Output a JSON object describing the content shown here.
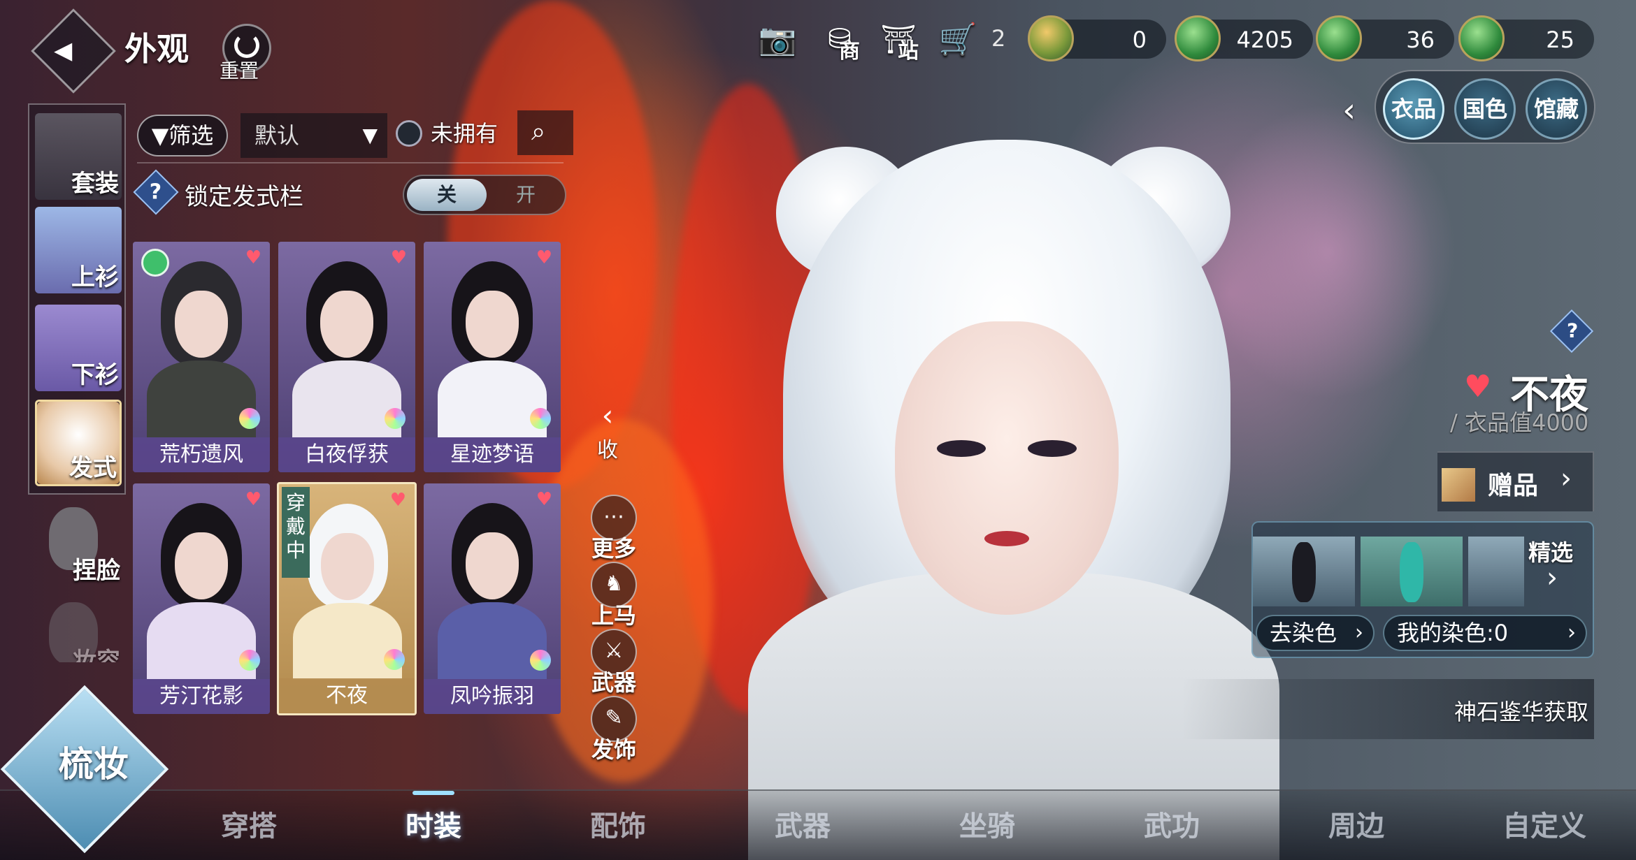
{
  "header": {
    "title": "外观",
    "reset_label": "重置",
    "back_icon": "back-arrow-icon",
    "shop_label": "商",
    "site_label": "站",
    "cart_count": "2"
  },
  "currencies": [
    {
      "icon": "jade-coin-icon",
      "value": "0"
    },
    {
      "icon": "green-jade-plus-icon",
      "value": "4205"
    },
    {
      "icon": "green-jade-plus-icon",
      "value": "36"
    },
    {
      "icon": "green-jade-plus-icon",
      "value": "25"
    }
  ],
  "right_tabs": {
    "items": [
      {
        "label": "衣品",
        "active": true
      },
      {
        "label": "国色",
        "active": false
      },
      {
        "label": "馆藏",
        "active": false
      }
    ]
  },
  "sidebar": {
    "items": [
      {
        "label": "套装"
      },
      {
        "label": "上衫"
      },
      {
        "label": "下衫"
      },
      {
        "label": "发式",
        "active": true
      },
      {
        "label": "捏脸"
      },
      {
        "label": "妆容"
      }
    ]
  },
  "filter": {
    "filter_label": "筛选",
    "sort_value": "默认",
    "not_owned_label": "未拥有",
    "lock_label": "锁定发式栏",
    "toggle_off": "关",
    "toggle_on": "开"
  },
  "items": [
    {
      "name": "荒朽遗风",
      "heart": "♥"
    },
    {
      "name": "白夜俘获",
      "heart": "♥"
    },
    {
      "name": "星迹梦语",
      "heart": "♥"
    },
    {
      "name": "芳汀花影",
      "heart": "♥"
    },
    {
      "name": "不夜",
      "heart": "♥",
      "wearing": "穿戴中",
      "selected": true
    },
    {
      "name": "凤吟振羽",
      "heart": "♥"
    }
  ],
  "actions": {
    "collapse": "收",
    "more": "更多",
    "mount": "上马",
    "weapon": "武器",
    "hair_accessory": "发饰"
  },
  "detail": {
    "name": "不夜",
    "value": "/ 衣品值4000",
    "gift_label": "赠品",
    "picks_label": "精选",
    "undye_label": "去染色",
    "my_dyes_label": "我的染色:0",
    "source_label": "神石鉴华获取"
  },
  "mode_badge": "梳妆",
  "bottom_nav": [
    {
      "label": "穿搭"
    },
    {
      "label": "时装",
      "active": true
    },
    {
      "label": "配饰"
    },
    {
      "label": "武器"
    },
    {
      "label": "坐骑"
    },
    {
      "label": "武功"
    },
    {
      "label": "周边"
    },
    {
      "label": "自定义"
    }
  ],
  "colors": {
    "accent": "#9fe0ff",
    "favorite": "#ff4c5e",
    "selected_card": "#d8b47a",
    "card": "#7c6aa2"
  }
}
